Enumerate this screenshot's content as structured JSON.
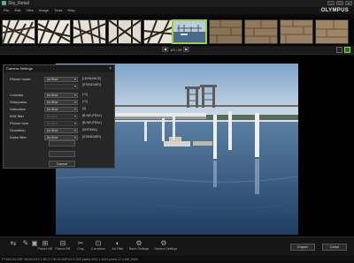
{
  "window": {
    "title": "Sky_Retail",
    "controls": [
      "_",
      "□",
      "×"
    ]
  },
  "menu": {
    "items": [
      "File",
      "Edit",
      "View",
      "Image",
      "Tools",
      "Help"
    ]
  },
  "brand": "OLYMPUS",
  "filmstrip": {
    "thumb_count": 10,
    "selected_index": 5
  },
  "pager": {
    "label": "1/9 / 29"
  },
  "dialog": {
    "title": "Camera Settings",
    "close": "×",
    "rows": [
      {
        "label": "Picture mode",
        "select": "As Shot",
        "value": "[i-ENHANCE] [STANDARD]",
        "disabled": false
      },
      {
        "label": "",
        "select": "",
        "value": "",
        "disabled": true
      },
      {
        "label": "Contrast",
        "select": "As Shot",
        "value": "[+1]",
        "disabled": false
      },
      {
        "label": "Sharpness",
        "select": "As Shot",
        "value": "[+1]",
        "disabled": false
      },
      {
        "label": "Saturation",
        "select": "As Shot",
        "value": "[0]",
        "disabled": false
      },
      {
        "label": "B/W filter",
        "select": "As Shot",
        "value": "[B-NEUTRAL]",
        "disabled": true
      },
      {
        "label": "Picture tone",
        "select": "As Shot",
        "value": "[B-NEUTRAL]",
        "disabled": true
      },
      {
        "label": "Gradation",
        "select": "As Shot",
        "value": "[NORMAL]",
        "disabled": false
      },
      {
        "label": "Noise filter",
        "select": "As Shot",
        "value": "[STANDARD]",
        "disabled": false
      }
    ],
    "buttons": [
      {
        "label": "",
        "disabled": true
      },
      {
        "label": "",
        "disabled": true
      },
      {
        "label": "Cancel",
        "disabled": false
      }
    ]
  },
  "toolbar": {
    "tools": [
      {
        "name": "tool-1",
        "icon": "⇆",
        "label": ""
      },
      {
        "name": "tool-2",
        "icon": "✎",
        "label": ""
      },
      {
        "name": "tool-3",
        "icon": "▣",
        "label": ""
      },
      {
        "name": "tool-4",
        "icon": "⊞",
        "label": "Picture NR"
      },
      {
        "name": "tool-5",
        "icon": "⊟",
        "label": "Picture NR"
      },
      {
        "name": "tool-6",
        "icon": "✂",
        "label": "Crop"
      },
      {
        "name": "tool-7",
        "icon": "⊡",
        "label": "Correction"
      },
      {
        "name": "tool-8",
        "icon": "◐",
        "label": "Art Filter"
      },
      {
        "name": "tool-9",
        "icon": "⚙",
        "label": "Basic Settings"
      },
      {
        "name": "tool-10",
        "icon": "⚙",
        "label": "Camera Settings"
      }
    ],
    "export_label": "Export",
    "close_label": "Close"
  },
  "status": {
    "text": "P7150134.ORF   06/20/2010 1:55:27 PM   OLYMPUS E-520 (data)   4032 x 3024 pixels   17.4 MB   100%"
  },
  "colors": {
    "accent": "#9ccf3a",
    "background": "#0a0a0a"
  }
}
